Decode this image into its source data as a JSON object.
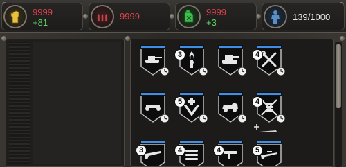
{
  "resources": {
    "food": {
      "value": "9999",
      "delta": "+81",
      "icon": "fist-icon",
      "color": "#e8c23c"
    },
    "ammo": {
      "value": "9999",
      "icon": "bullets-icon",
      "color": "#c2464a"
    },
    "fuel": {
      "value": "9999",
      "delta": "+3",
      "icon": "fuel-can-icon",
      "color": "#3fc04c"
    },
    "population": {
      "value": "139/1000",
      "icon": "soldier-icon",
      "color": "#5b8ec8"
    }
  },
  "colors": {
    "value_red": "#e2414a",
    "delta_green": "#5fd468",
    "card_bar_blue": "#3f8ee8"
  },
  "units": [
    {
      "name": "light-tank",
      "count": "",
      "icon": "light-tank-icon"
    },
    {
      "name": "flamethrower",
      "count": "3",
      "icon": "flamethrower-icon"
    },
    {
      "name": "medium-tank",
      "count": "",
      "icon": "tank-icon"
    },
    {
      "name": "engineer",
      "count": "4",
      "icon": "wrench-tools-icon"
    },
    {
      "name": "truck",
      "count": "",
      "icon": "truck-icon"
    },
    {
      "name": "medic",
      "count": "5",
      "icon": "medic-chevron-icon"
    },
    {
      "name": "armored-car",
      "count": "",
      "icon": "armored-car-icon"
    },
    {
      "name": "officer",
      "count": "4",
      "icon": "crossed-rifles-icon"
    },
    {
      "name": "rifleman",
      "count": "3",
      "icon": "rifle-icon"
    },
    {
      "name": "mortar",
      "count": "4",
      "icon": "mortar-icon"
    },
    {
      "name": "anti-tank",
      "count": "4",
      "icon": "antitank-icon"
    },
    {
      "name": "sniper",
      "count": "5",
      "icon": "sniper-icon"
    }
  ]
}
